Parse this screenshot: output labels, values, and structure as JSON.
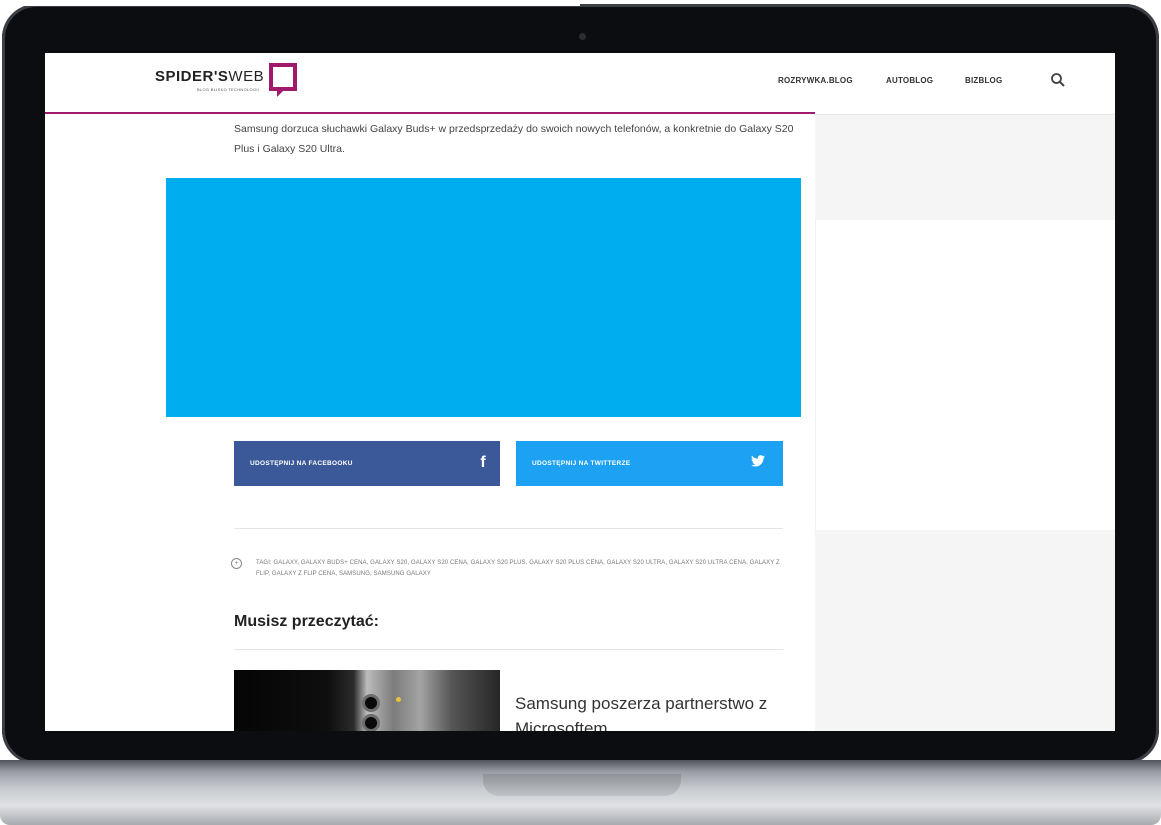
{
  "header": {
    "logo_bold": "SPIDER'S",
    "logo_thin": "WEB",
    "logo_tagline": "BLOG BLISKO TECHNOLOGII",
    "nav": [
      "ROZRYWKA.BLOG",
      "AUTOBLOG",
      "BIZBLOG"
    ],
    "search_icon": "search-icon",
    "accent": "#a0196b"
  },
  "article": {
    "lead": "Samsung dorzuca słuchawki Galaxy Buds+ w przedsprzedaży do swoich nowych telefonów, a konkretnie do Galaxy S20 Plus i Galaxy S20 Ultra.",
    "hero_color": "#00aeef"
  },
  "share": {
    "facebook_label": "UDOSTĘPNIJ NA FACEBOOKU",
    "facebook_color": "#3b5998",
    "twitter_label": "UDOSTĘPNIJ NA TWITTERZE",
    "twitter_color": "#1da1f2"
  },
  "tags": {
    "text": "TAGI: GALAXY, GALAXY BUDS+ CENA, GALAXY S20, GALAXY S20 CENA, GALAXY S20 PLUS, GALAXY S20 PLUS CENA, GALAXY S20 ULTRA, GALAXY S20 ULTRA CENA, GALAXY Z FLIP, GALAXY Z FLIP CENA, SAMSUNG, SAMSUNG GALAXY"
  },
  "related": {
    "section_title": "Musisz przeczytać:",
    "item_title": "Samsung poszerza partnerstwo z Microsoftem"
  }
}
